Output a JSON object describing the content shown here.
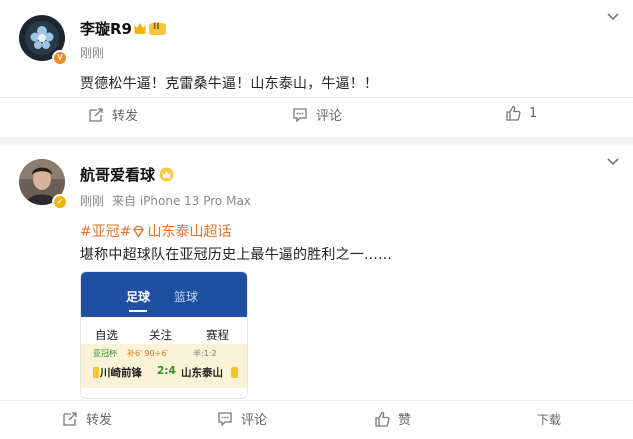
{
  "post1": {
    "author": "李璇R9",
    "time": "刚刚",
    "text": "贾德松牛逼！克雷桑牛逼！山东泰山，牛逼！！",
    "badge": "V",
    "vip_label": "II",
    "actions": {
      "repost": "转发",
      "comment": "评论",
      "like_count": "1"
    }
  },
  "post2": {
    "author": "航哥爱看球",
    "time": "刚刚",
    "source": "来自 iPhone 13 Pro Max",
    "topic_1": "#亚冠#",
    "topic_2": "山东泰山超话",
    "text": "堪称中超球队在亚冠历史上最牛逼的胜利之一......",
    "embed": {
      "tabs": [
        "足球",
        "篮球"
      ],
      "sub_tabs": [
        "自选",
        "关注",
        "赛程"
      ],
      "match": {
        "league": "亚冠杯",
        "info": "补6′  90+6′",
        "half": "半:1:2",
        "home": "川崎前锋",
        "score": "2:4",
        "away": "山东泰山"
      }
    },
    "actions": {
      "repost": "转发",
      "comment": "评论",
      "like": "赞",
      "download": "下载"
    }
  },
  "colors": {
    "topic": "#e8722c",
    "embed_header": "#1f4fa1",
    "verified_orange": "#f08a24",
    "verified_gold": "#f4b400"
  }
}
